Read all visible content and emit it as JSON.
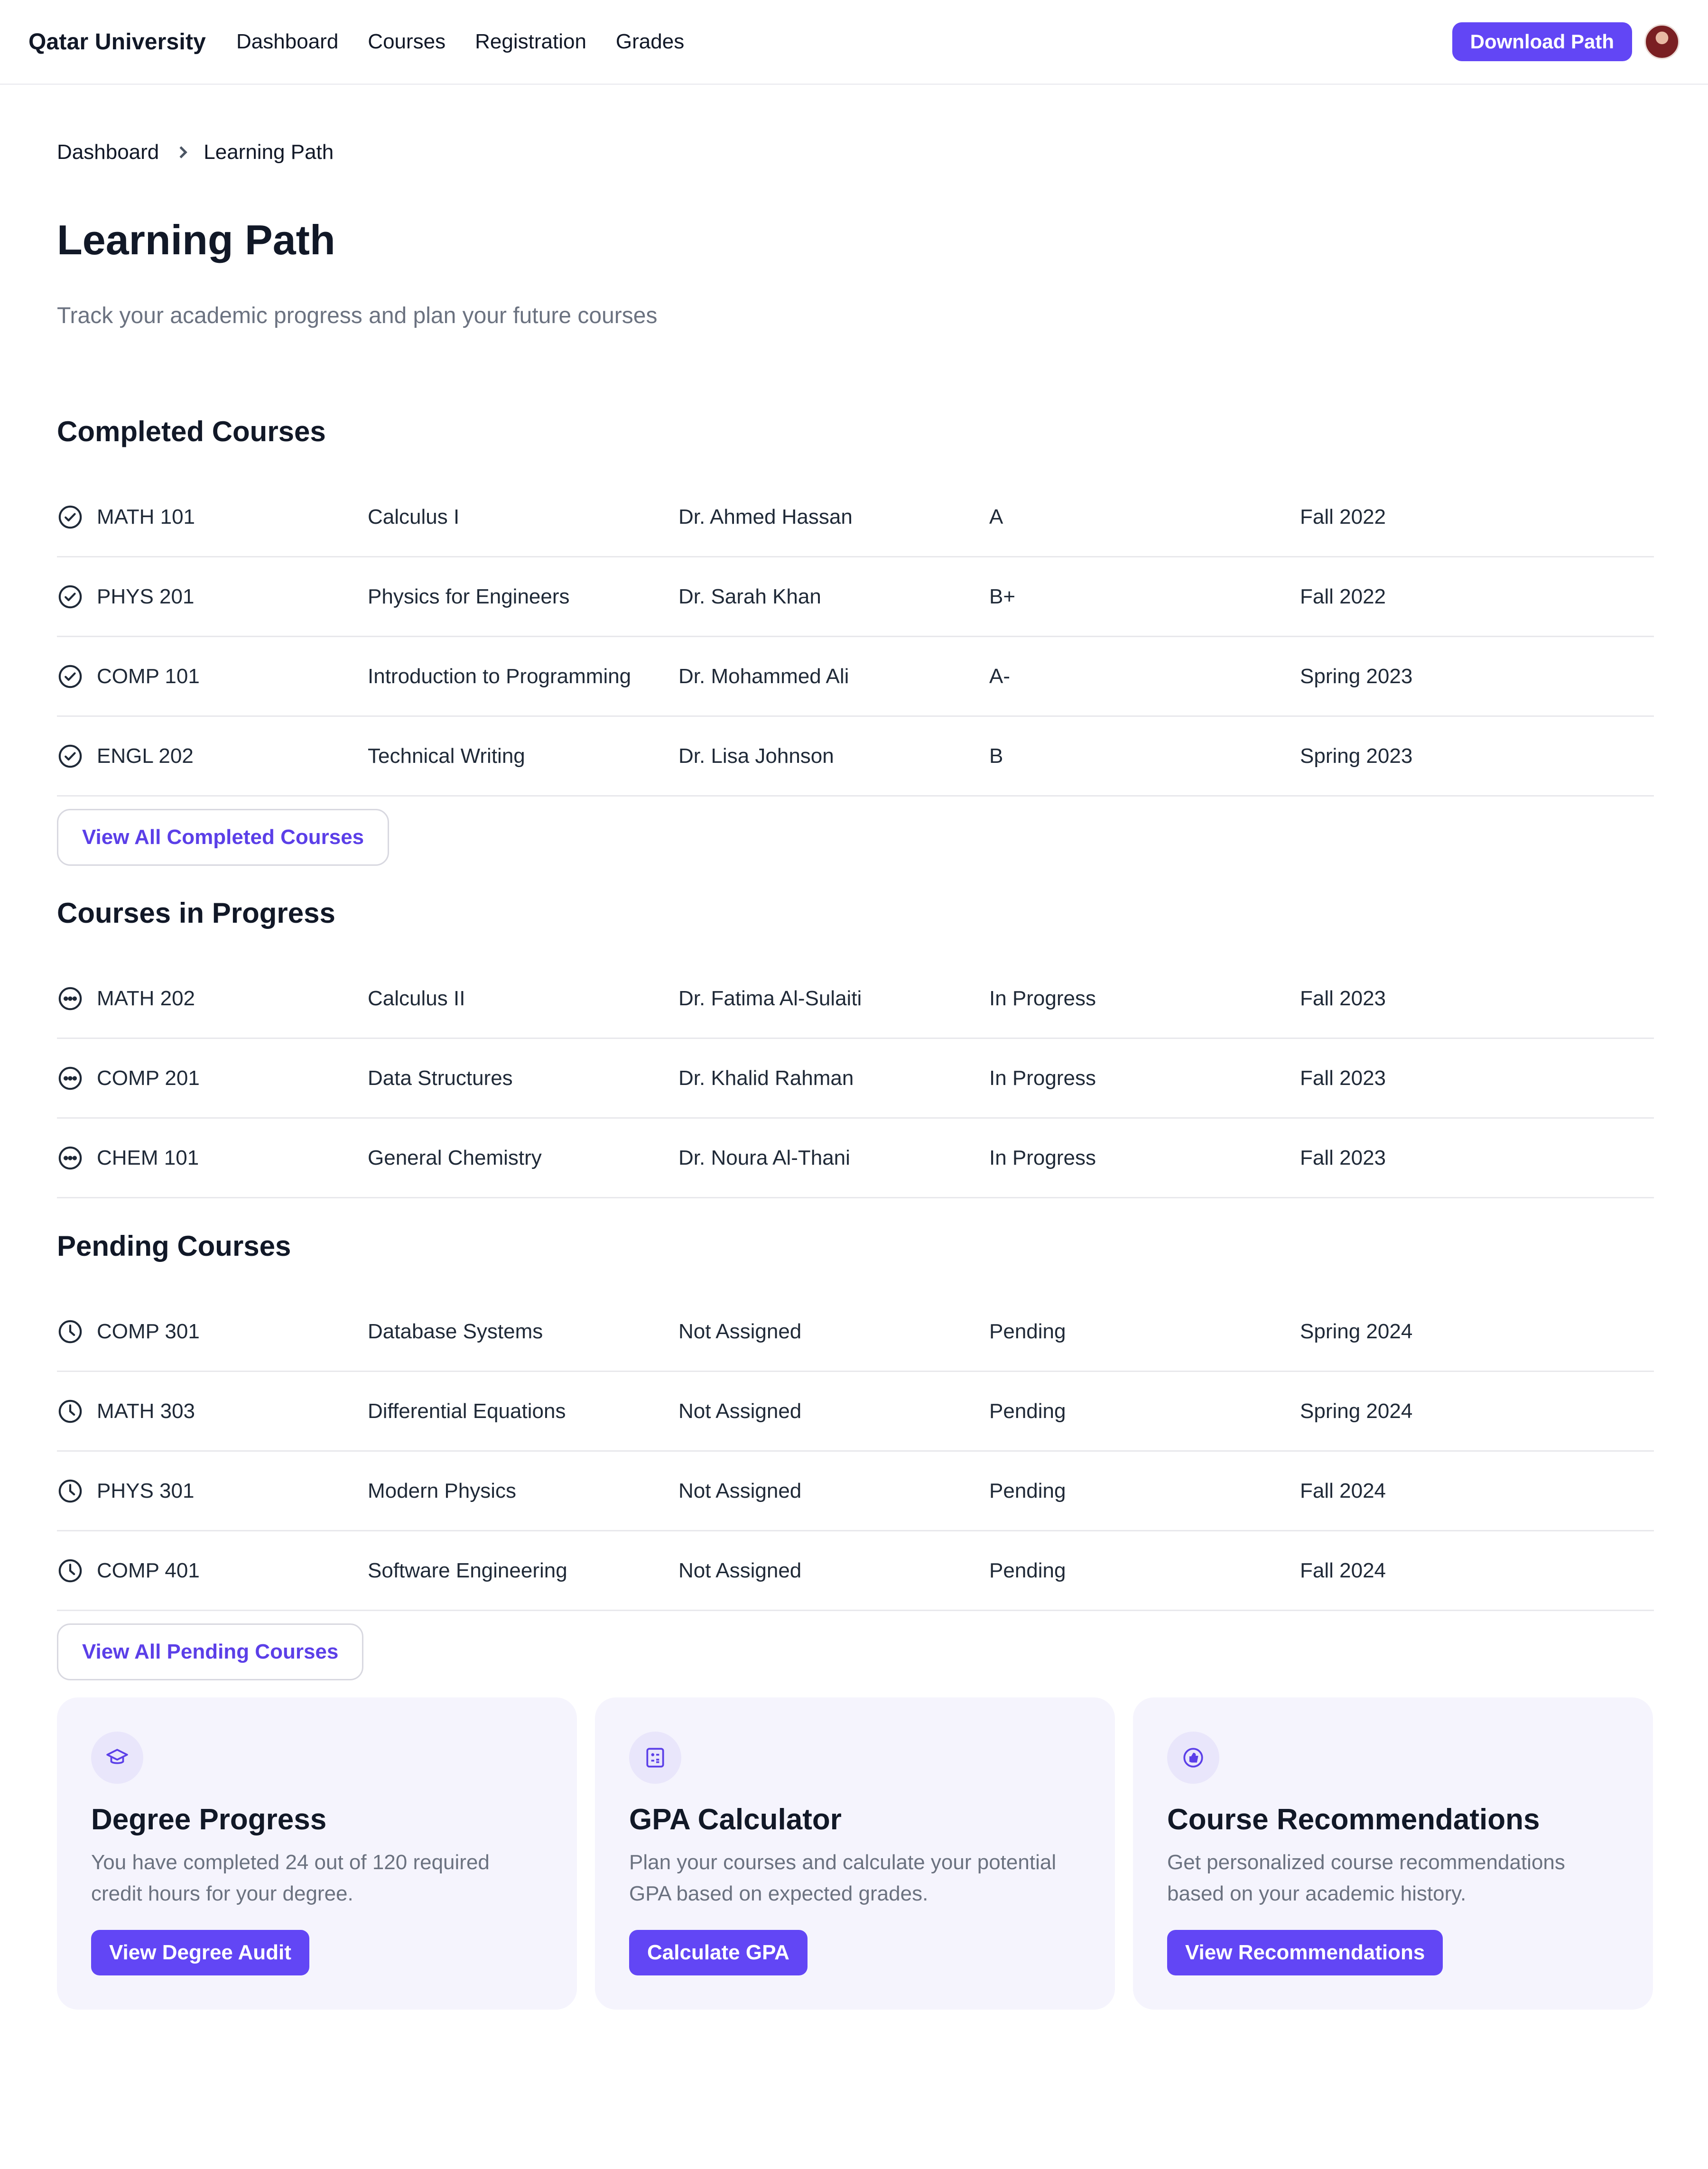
{
  "header": {
    "brand": "Qatar University",
    "nav": [
      "Dashboard",
      "Courses",
      "Registration",
      "Grades"
    ],
    "download_label": "Download Path"
  },
  "breadcrumb": [
    "Dashboard",
    "Learning Path"
  ],
  "page": {
    "title": "Learning Path",
    "subtitle": "Track your academic progress and plan your future courses"
  },
  "completed": {
    "title": "Completed Courses",
    "rows": [
      {
        "code": "MATH 101",
        "name": "Calculus I",
        "instructor": "Dr. Ahmed Hassan",
        "grade": "A",
        "term": "Fall 2022"
      },
      {
        "code": "PHYS 201",
        "name": "Physics for Engineers",
        "instructor": "Dr. Sarah Khan",
        "grade": "B+",
        "term": "Fall 2022"
      },
      {
        "code": "COMP 101",
        "name": "Introduction to Programming",
        "instructor": "Dr. Mohammed Ali",
        "grade": "A-",
        "term": "Spring 2023"
      },
      {
        "code": "ENGL 202",
        "name": "Technical Writing",
        "instructor": "Dr. Lisa Johnson",
        "grade": "B",
        "term": "Spring 2023"
      }
    ],
    "button": "View All Completed Courses"
  },
  "in_progress": {
    "title": "Courses in Progress",
    "rows": [
      {
        "code": "MATH 202",
        "name": "Calculus II",
        "instructor": "Dr. Fatima Al-Sulaiti",
        "grade": "In Progress",
        "term": "Fall 2023"
      },
      {
        "code": "COMP 201",
        "name": "Data Structures",
        "instructor": "Dr. Khalid Rahman",
        "grade": "In Progress",
        "term": "Fall 2023"
      },
      {
        "code": "CHEM 101",
        "name": "General Chemistry",
        "instructor": "Dr. Noura Al-Thani",
        "grade": "In Progress",
        "term": "Fall 2023"
      }
    ]
  },
  "pending": {
    "title": "Pending Courses",
    "rows": [
      {
        "code": "COMP 301",
        "name": "Database Systems",
        "instructor": "Not Assigned",
        "grade": "Pending",
        "term": "Spring 2024"
      },
      {
        "code": "MATH 303",
        "name": "Differential Equations",
        "instructor": "Not Assigned",
        "grade": "Pending",
        "term": "Spring 2024"
      },
      {
        "code": "PHYS 301",
        "name": "Modern Physics",
        "instructor": "Not Assigned",
        "grade": "Pending",
        "term": "Fall 2024"
      },
      {
        "code": "COMP 401",
        "name": "Software Engineering",
        "instructor": "Not Assigned",
        "grade": "Pending",
        "term": "Fall 2024"
      }
    ],
    "button": "View All Pending Courses"
  },
  "cards": [
    {
      "icon": "graduation-cap-icon",
      "title": "Degree Progress",
      "desc": "You have completed 24 out of 120 required credit hours for your degree.",
      "button": "View Degree Audit"
    },
    {
      "icon": "calculator-icon",
      "title": "GPA Calculator",
      "desc": "Plan your courses and calculate your potential GPA based on expected grades.",
      "button": "Calculate GPA"
    },
    {
      "icon": "thumbs-up-icon",
      "title": "Course Recommendations",
      "desc": "Get personalized course recommendations based on your academic history.",
      "button": "View Recommendations"
    }
  ],
  "colors": {
    "accent": "#6246f5",
    "card_bg": "#f5f4fd"
  }
}
